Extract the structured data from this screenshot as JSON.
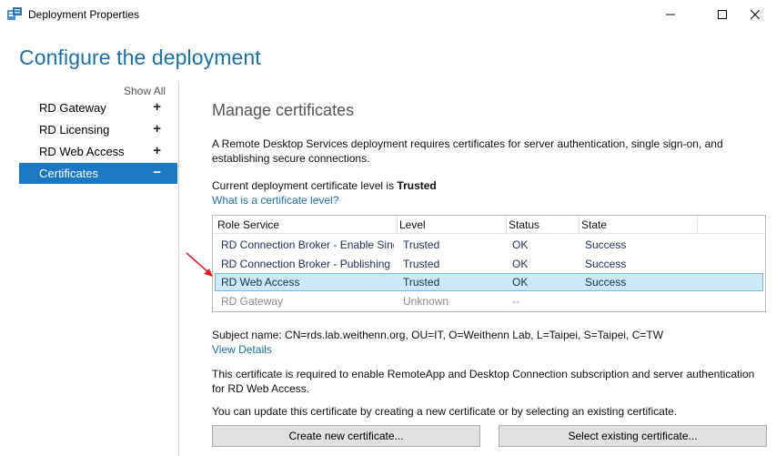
{
  "window": {
    "title": "Deployment Properties"
  },
  "page": {
    "heading": "Configure the deployment"
  },
  "sidebar": {
    "show_all": "Show All",
    "items": [
      {
        "label": "RD Gateway",
        "sign": "+"
      },
      {
        "label": "RD Licensing",
        "sign": "+"
      },
      {
        "label": "RD Web Access",
        "sign": "+"
      },
      {
        "label": "Certificates",
        "sign": "−"
      }
    ]
  },
  "main": {
    "section_title": "Manage certificates",
    "description": "A Remote Desktop Services deployment requires certificates for server authentication, single sign-on, and establishing secure connections.",
    "level_prefix": "Current deployment certificate level is ",
    "level_value": "Trusted",
    "level_link": "What is a certificate level?",
    "table": {
      "headers": [
        "Role Service",
        "Level",
        "Status",
        "State"
      ],
      "rows": [
        {
          "role": "RD Connection Broker - Enable Single Sign On",
          "level": "Trusted",
          "status": "OK",
          "state": "Success"
        },
        {
          "role": "RD Connection Broker - Publishing",
          "level": "Trusted",
          "status": "OK",
          "state": "Success"
        },
        {
          "role": "RD Web Access",
          "level": "Trusted",
          "status": "OK",
          "state": "Success"
        },
        {
          "role": "RD Gateway",
          "level": "Unknown",
          "status": "--",
          "state": ""
        }
      ]
    },
    "subject_name": "Subject name: CN=rds.lab.weithenn.org, OU=IT, O=Weithenn Lab, L=Taipei, S=Taipei, C=TW",
    "view_details": "View Details",
    "cert_description": "This certificate is required to enable RemoteApp and Desktop Connection subscription and server authentication for RD Web Access.",
    "update_text": "You can update this certificate by creating a new certificate or by selecting an existing certificate.",
    "buttons": {
      "create": "Create new certificate...",
      "select": "Select existing certificate..."
    }
  },
  "colors": {
    "accent": "#1b79c4",
    "heading": "#1d6fa5",
    "selected_row": "#cde8f8",
    "arrow": "#e02020"
  }
}
